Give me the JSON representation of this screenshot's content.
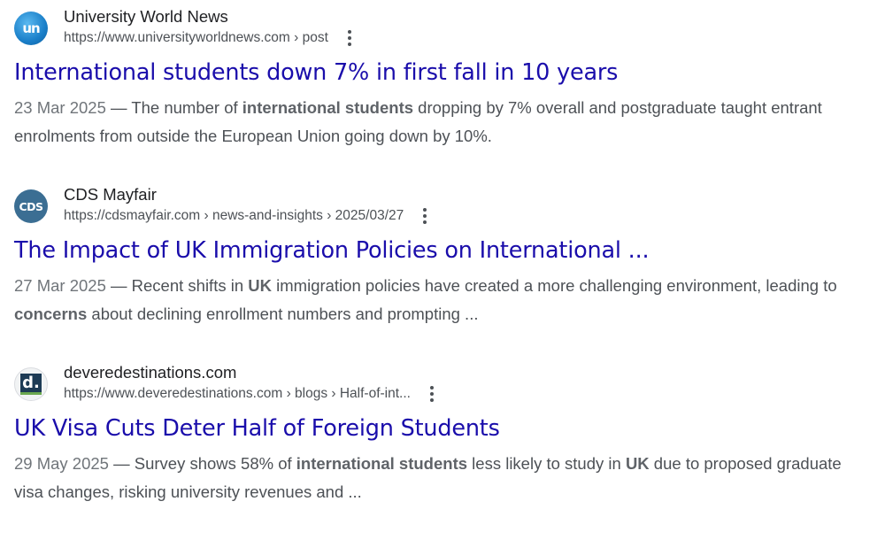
{
  "results": [
    {
      "favicon_text": "un",
      "favicon_icon": "university-world-news-logo-icon",
      "site_name": "University World News",
      "url": "https://www.universityworldnews.com › post",
      "title": "International students down 7% in first fall in 10 years",
      "date": "23 Mar 2025",
      "snippet_parts": [
        {
          "text": " — The number of ",
          "bold": false
        },
        {
          "text": "international students",
          "bold": true
        },
        {
          "text": " dropping by 7% overall and postgraduate taught entrant enrolments from outside the European Union going down by 10%.",
          "bold": false
        }
      ]
    },
    {
      "favicon_text": "CDS",
      "favicon_icon": "cds-mayfair-logo-icon",
      "site_name": "CDS Mayfair",
      "url": "https://cdsmayfair.com › news-and-insights › 2025/03/27",
      "title": "The Impact of UK Immigration Policies on International ...",
      "date": "27 Mar 2025",
      "snippet_parts": [
        {
          "text": " — Recent shifts in ",
          "bold": false
        },
        {
          "text": "UK",
          "bold": true
        },
        {
          "text": " immigration policies have created a more challenging environment, leading to ",
          "bold": false
        },
        {
          "text": "concerns",
          "bold": true
        },
        {
          "text": " about declining enrollment numbers and prompting ...",
          "bold": false
        }
      ]
    },
    {
      "favicon_text": "d.",
      "favicon_icon": "devere-destinations-logo-icon",
      "site_name": "deveredestinations.com",
      "url": "https://www.deveredestinations.com › blogs › Half-of-int...",
      "title": "UK Visa Cuts Deter Half of Foreign Students",
      "date": "29 May 2025",
      "snippet_parts": [
        {
          "text": " — Survey shows 58% of ",
          "bold": false
        },
        {
          "text": "international students",
          "bold": true
        },
        {
          "text": " less likely to study in ",
          "bold": false
        },
        {
          "text": "UK",
          "bold": true
        },
        {
          "text": " due to proposed graduate visa changes, risking university revenues and ...",
          "bold": false
        }
      ]
    }
  ],
  "icons": {
    "more_options": "three-dots-vertical-icon"
  },
  "colors": {
    "title_link": "#1a0dab",
    "url_text": "#4d5156",
    "snippet_text": "#4d5156"
  }
}
